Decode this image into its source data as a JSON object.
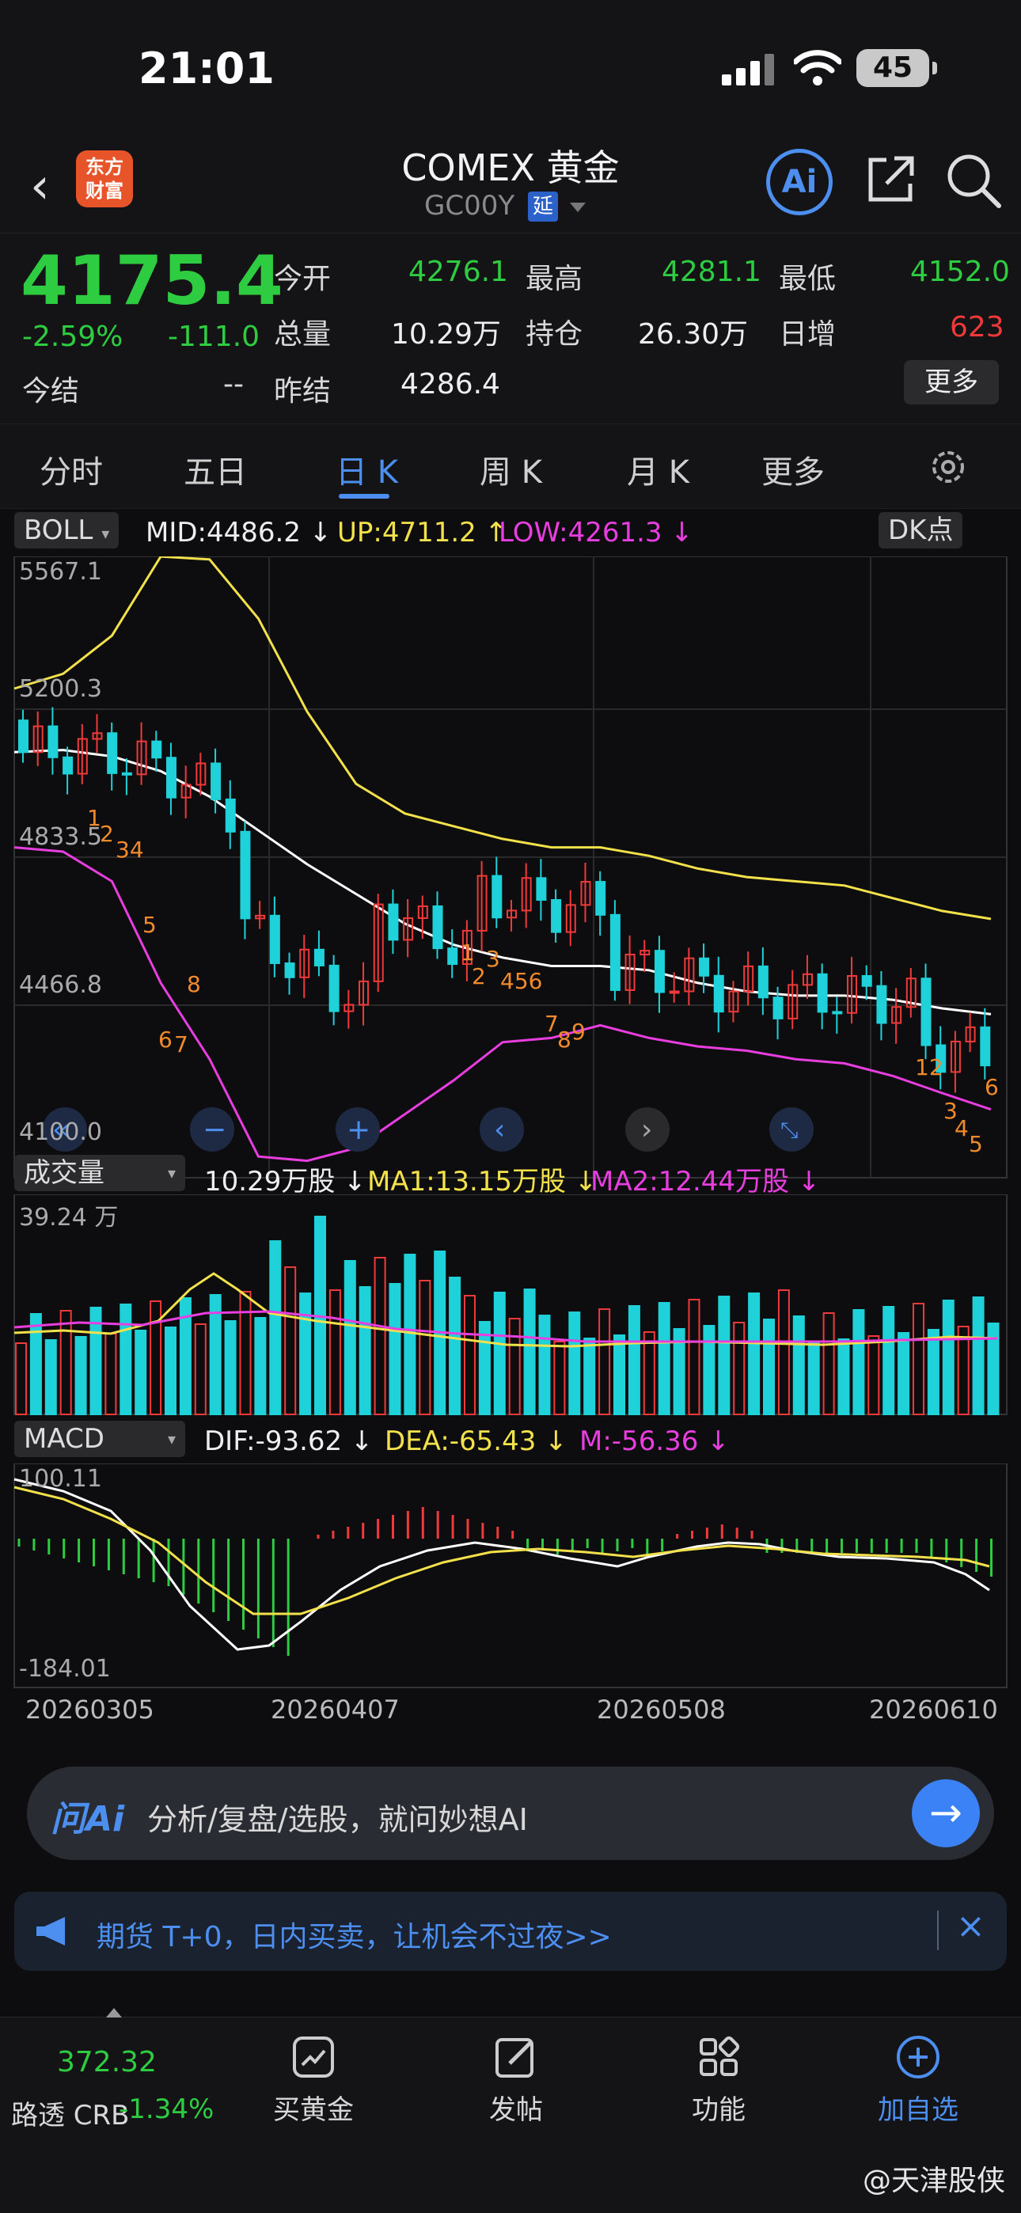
{
  "status_bar": {
    "time": "21:01",
    "battery": "45"
  },
  "header": {
    "back_icon": "chevron-left-icon",
    "logo_line1": "东方",
    "logo_line2": "财富",
    "title": "COMEX 黄金",
    "code": "GC00Y",
    "delay_badge": "延",
    "ai_label": "Ai"
  },
  "quote": {
    "price": "4175.4",
    "change_pct": "-2.59%",
    "change": "-111.0",
    "open_label": "今开",
    "open": "4276.1",
    "high_label": "最高",
    "high": "4281.1",
    "low_label": "最低",
    "low": "4152.0",
    "volume_label": "总量",
    "volume": "10.29万",
    "position_label": "持仓",
    "position": "26.30万",
    "daily_inc_label": "日增",
    "daily_inc": "623",
    "settle_label": "今结",
    "settle": "--",
    "prev_settle_label": "昨结",
    "prev_settle": "4286.4",
    "more_label": "更多"
  },
  "tabs": [
    {
      "label": "分时"
    },
    {
      "label": "五日"
    },
    {
      "label": "日 K"
    },
    {
      "label": "周 K"
    },
    {
      "label": "月 K"
    },
    {
      "label": "更多"
    }
  ],
  "boll": {
    "selector": "BOLL",
    "mid": "MID:4486.2 ↓",
    "up": "UP:4711.2 ↑",
    "low": "LOW:4261.3 ↓",
    "dk": "DK点"
  },
  "price_axis": [
    "5567.1",
    "5200.3",
    "4833.5",
    "4466.8",
    "4100.0"
  ],
  "volume_panel": {
    "selector": "成交量",
    "value": "10.29万股 ↓",
    "ma1": "MA1:13.15万股 ↓",
    "ma2": "MA2:12.44万股 ↓",
    "max": "39.24 万"
  },
  "macd_panel": {
    "selector": "MACD",
    "dif": "DIF:-93.62 ↓",
    "dea": "DEA:-65.43 ↓",
    "m": "M:-56.36 ↓",
    "top": "100.11",
    "bottom": "-184.01"
  },
  "dates": [
    "20260305",
    "20260407",
    "20260508",
    "20260610"
  ],
  "ask_bar": {
    "brand": "问Ai",
    "placeholder": "分析/复盘/选股，就问妙想AI"
  },
  "banner": {
    "text": "期货 T+0，日内买卖，让机会不过夜>>",
    "close": "×"
  },
  "bottom_nav": {
    "ticker_value": "372.32",
    "ticker_label": "路透 CRB",
    "ticker_change": "-1.34%",
    "items": [
      {
        "label": "买黄金",
        "icon": "chart-buy-icon"
      },
      {
        "label": "发帖",
        "icon": "edit-icon"
      },
      {
        "label": "功能",
        "icon": "grid-icon"
      },
      {
        "label": "加自选",
        "icon": "plus-circle-icon"
      }
    ]
  },
  "watermark": "@天津股侠",
  "colors": {
    "up": "#f03a3a",
    "down": "#2ecc40",
    "candle_down": "#1fd1d8",
    "accent": "#4c8ff0",
    "boll_up": "#f2e14a",
    "boll_low": "#e83ee0"
  },
  "chart_data": {
    "type": "candlestick",
    "series": [
      {
        "name": "MID",
        "values": [
          5105,
          5110,
          5095,
          5060,
          5000,
          4920,
          4840,
          4770,
          4700,
          4650,
          4620,
          4600,
          4600,
          4590,
          4560,
          4540,
          4530,
          4530,
          4520,
          4500,
          4486.2
        ]
      },
      {
        "name": "UP",
        "values": [
          5255,
          5290,
          5380,
          5567,
          5560,
          5420,
          5200,
          5030,
          4960,
          4930,
          4900,
          4880,
          4880,
          4860,
          4830,
          4810,
          4800,
          4790,
          4760,
          4730,
          4711.2
        ]
      },
      {
        "name": "LOW",
        "values": [
          4880,
          4870,
          4800,
          4560,
          4380,
          4150,
          4140,
          4170,
          4250,
          4330,
          4420,
          4430,
          4460,
          4430,
          4410,
          4400,
          4380,
          4370,
          4340,
          4300,
          4261.3
        ]
      }
    ],
    "ylim": [
      4100.0,
      5567.1
    ]
  }
}
